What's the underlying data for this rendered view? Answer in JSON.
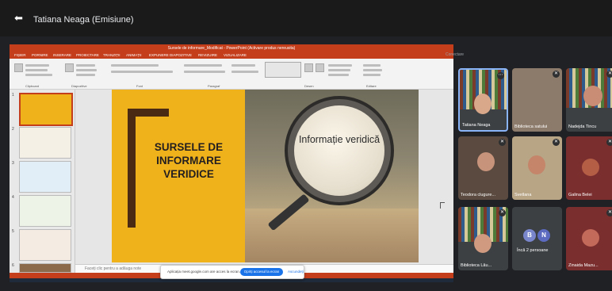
{
  "header": {
    "presenter_label": "Tatiana Neaga (Emisiune)"
  },
  "window": {
    "title": "Sursele de informare_Modificat - PowerPoint (Activare produs nereusita)",
    "tabs": [
      "FIȘIER",
      "PORNIRE",
      "INSERARE",
      "PROIECTARE",
      "TRANZIȚII",
      "ANIMAȚII",
      "EXPUNERE DIAPOZITIVE",
      "REVIZUIRE",
      "VIZUALIZARE"
    ],
    "groups": [
      "Clipboard",
      "Diapozitive",
      "Font",
      "Paragraf",
      "Desen",
      "Editare"
    ],
    "corner_label": "Conectare"
  },
  "slide": {
    "title": "SURSELE DE INFORMARE VERIDICE",
    "lens_text": "Informație veridică"
  },
  "thumbnails": [
    "1",
    "2",
    "3",
    "4",
    "5",
    "6"
  ],
  "notes": {
    "placeholder": "Faceți clic pentru a adăuga note"
  },
  "meet_bar": {
    "message": "Aplicația meet.google.com are acces la ecran.",
    "stop_button": "Opriți accesul la ecran",
    "hide_link": "Ascundeți"
  },
  "participants": [
    {
      "name": "Tatiana Neaga"
    },
    {
      "name": "Biblioteca satului"
    },
    {
      "name": "Nadejda Tincu"
    },
    {
      "name": "Teodora clugure..."
    },
    {
      "name": "Svetlana"
    },
    {
      "name": "Galina Belei"
    },
    {
      "name": "Biblioteca Lău..."
    },
    {
      "name": "Încă 2 persoane",
      "avatars": [
        "B",
        "N"
      ]
    },
    {
      "name": "Zinaida Mazu..."
    }
  ],
  "colors": {
    "accent": "#c43e1c",
    "meet_blue": "#1a73e8",
    "slide_yellow": "#f0b21a"
  }
}
